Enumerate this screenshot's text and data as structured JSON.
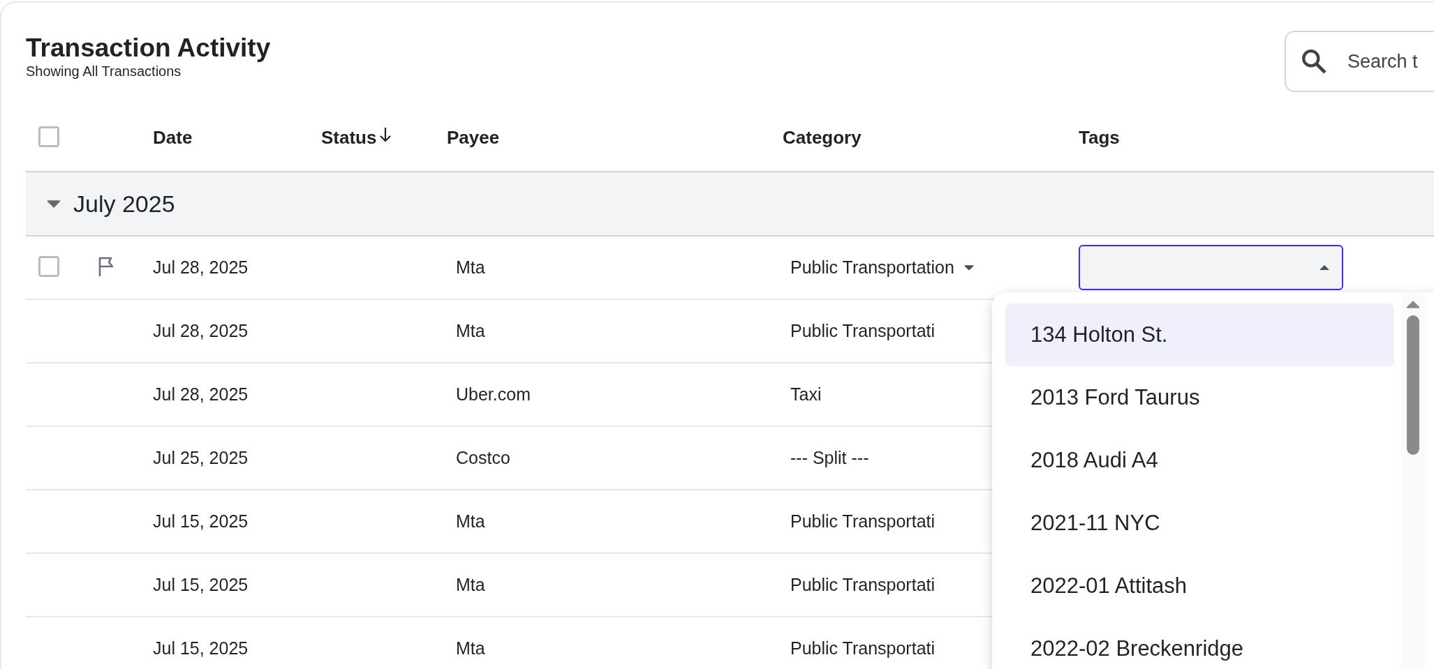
{
  "header": {
    "title": "Transaction Activity",
    "subtitle": "Showing All Transactions"
  },
  "search": {
    "placeholder": "Search t"
  },
  "table": {
    "select_all": {
      "checked": false
    },
    "columns": [
      {
        "label": "Date",
        "sorted": false
      },
      {
        "label": "Status",
        "sorted": true
      },
      {
        "label": "Payee",
        "sorted": false
      },
      {
        "label": "Category",
        "sorted": false
      },
      {
        "label": "Tags",
        "sorted": false
      }
    ],
    "groups": [
      {
        "label": "July 2025",
        "expanded": true,
        "rows": [
          {
            "kind": "editing",
            "checked": false,
            "date": "Jul 28, 2025",
            "payee": "Mta",
            "category": "Public Transportation",
            "tags": {
              "open": true,
              "options": [
                {
                  "label": "134 Holton St.",
                  "selected": true
                },
                {
                  "label": "2013 Ford Taurus",
                  "selected": false
                },
                {
                  "label": "2018 Audi A4",
                  "selected": false
                },
                {
                  "label": "2021-11 NYC",
                  "selected": false
                },
                {
                  "label": "2022-01 Attitash",
                  "selected": false
                },
                {
                  "label": "2022-02 Breckenridge",
                  "selected": false
                }
              ]
            }
          },
          {
            "kind": "plain",
            "date": "Jul 28, 2025",
            "payee": "Mta",
            "category": "Public Transportati"
          },
          {
            "kind": "plain",
            "date": "Jul 28, 2025",
            "payee": "Uber.com",
            "category": "Taxi"
          },
          {
            "kind": "plain",
            "date": "Jul 25, 2025",
            "payee": "Costco",
            "category": "--- Split ---"
          },
          {
            "kind": "plain",
            "date": "Jul 15, 2025",
            "payee": "Mta",
            "category": "Public Transportati"
          },
          {
            "kind": "plain",
            "date": "Jul 15, 2025",
            "payee": "Mta",
            "category": "Public Transportati"
          },
          {
            "kind": "plain",
            "date": "Jul 15, 2025",
            "payee": "Mta",
            "category": "Public Transportati"
          }
        ]
      }
    ]
  }
}
